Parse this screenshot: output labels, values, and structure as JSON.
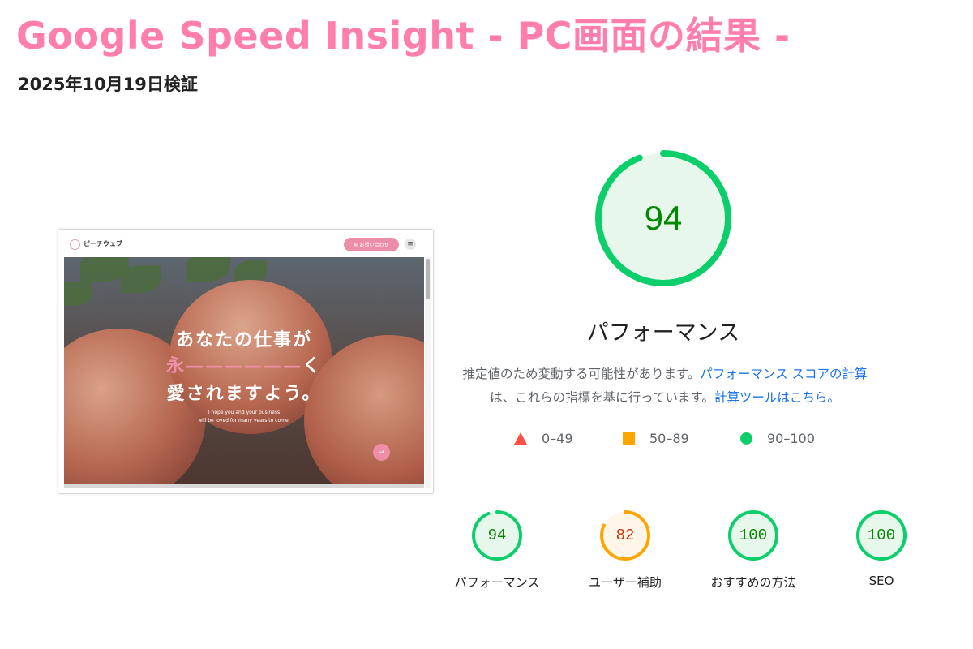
{
  "header": {
    "title": "Google Speed Insight - PC画面の結果 -",
    "date": "2025年10月19日検証"
  },
  "colors": {
    "title_pink": "#ff7eac",
    "pass": "#0cce6b",
    "pass_text": "#008800",
    "pass_bg": "#e8f7ec",
    "average": "#ffa400",
    "average_text": "#c33300",
    "average_bg": "#fff5e8",
    "fail": "#ff4e42",
    "link": "#1a73e8",
    "site_pink": "#ec8ea6"
  },
  "screenshot": {
    "logo_text": "ピーチウェブ",
    "contact_label": "✉ お問い合わせ",
    "menu_icon": "≡",
    "hero_line1": "あなたの仕事が",
    "hero_line2_accent": "永",
    "hero_line2_dash": "——————",
    "hero_line2_end": "く",
    "hero_line3": "愛されますよう。",
    "hero_en_1": "I hope you and your business",
    "hero_en_2": "will be loved for many years to come.",
    "arrow_icon": "→"
  },
  "main_score": {
    "value": 94,
    "label": "パフォーマンス"
  },
  "note": {
    "text1": "推定値のため変動する可能性があります。",
    "link1": "パフォーマンス スコアの計算",
    "text2": "は、これらの指標を基に行っています。",
    "link2": "計算ツールはこちら。"
  },
  "legend": {
    "fail_label": "0–49",
    "average_label": "50–89",
    "pass_label": "90–100"
  },
  "categories": [
    {
      "label": "パフォーマンス",
      "score": 94,
      "status": "pass"
    },
    {
      "label": "ユーザー補助",
      "score": 82,
      "status": "average"
    },
    {
      "label": "おすすめの方法",
      "score": 100,
      "status": "pass"
    },
    {
      "label": "SEO",
      "score": 100,
      "status": "pass"
    }
  ]
}
